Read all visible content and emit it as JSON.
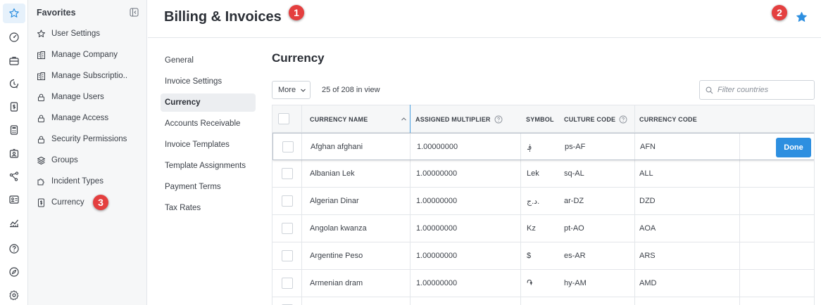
{
  "rail": {
    "icons": [
      "star-icon",
      "dashboard-icon",
      "briefcase-icon",
      "clock-dollar-icon",
      "dollar-doc-icon",
      "calculator-icon",
      "id-badge-icon",
      "share-nodes-icon",
      "contact-card-icon",
      "analytics-icon",
      "help-icon",
      "compass-icon",
      "gear-icon"
    ]
  },
  "favorites": {
    "title": "Favorites",
    "items": [
      {
        "label": "User Settings",
        "icon": "star-icon"
      },
      {
        "label": "Manage Company",
        "icon": "building-icon"
      },
      {
        "label": "Manage Subscriptio..",
        "icon": "building-icon"
      },
      {
        "label": "Manage Users",
        "icon": "lock-icon"
      },
      {
        "label": "Manage Access",
        "icon": "lock-icon"
      },
      {
        "label": "Security Permissions",
        "icon": "lock-icon"
      },
      {
        "label": "Groups",
        "icon": "layers-icon"
      },
      {
        "label": "Incident Types",
        "icon": "puzzle-icon"
      },
      {
        "label": "Currency",
        "icon": "dollar-doc-icon"
      }
    ]
  },
  "header": {
    "title": "Billing & Invoices"
  },
  "badges": [
    "1",
    "2",
    "3"
  ],
  "subnav": {
    "items": [
      "General",
      "Invoice Settings",
      "Currency",
      "Accounts Receivable",
      "Invoice Templates",
      "Template Assignments",
      "Payment Terms",
      "Tax Rates"
    ],
    "active": "Currency"
  },
  "content": {
    "title": "Currency",
    "more_label": "More",
    "count": "25 of 208 in view",
    "filter_placeholder": "Filter countries"
  },
  "table": {
    "columns": [
      "CURRENCY NAME",
      "ASSIGNED MULTIPLIER",
      "SYMBOL",
      "CULTURE CODE",
      "CURRENCY CODE"
    ],
    "rows": [
      {
        "name": "Afghan afghani",
        "multiplier": "1.00000000",
        "symbol": "؋",
        "culture": "ps-AF",
        "code": "AFN"
      },
      {
        "name": "Albanian Lek",
        "multiplier": "1.00000000",
        "symbol": "Lek",
        "culture": "sq-AL",
        "code": "ALL"
      },
      {
        "name": "Algerian Dinar",
        "multiplier": "1.00000000",
        "symbol": "د.ج.",
        "culture": "ar-DZ",
        "code": "DZD"
      },
      {
        "name": "Angolan kwanza",
        "multiplier": "1.00000000",
        "symbol": "Kz",
        "culture": "pt-AO",
        "code": "AOA"
      },
      {
        "name": "Argentine Peso",
        "multiplier": "1.00000000",
        "symbol": "$",
        "culture": "es-AR",
        "code": "ARS"
      },
      {
        "name": "Armenian dram",
        "multiplier": "1.00000000",
        "symbol": "֏",
        "culture": "hy-AM",
        "code": "AMD"
      }
    ],
    "done_label": "Done"
  },
  "colors": {
    "accent": "#2d8fe0",
    "badge": "#e43f3f",
    "active_bg": "#eceef1"
  }
}
